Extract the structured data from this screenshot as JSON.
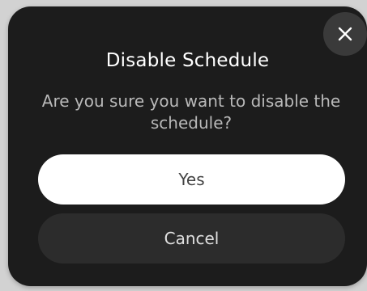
{
  "dialog": {
    "title": "Disable Schedule",
    "message": "Are you sure you want to disable the schedule?",
    "confirm_label": "Yes",
    "cancel_label": "Cancel",
    "close_icon": "close-icon"
  },
  "colors": {
    "modal_background": "#1c1c1c",
    "confirm_button": "#ffffff",
    "cancel_button": "#2c2c2c",
    "close_button": "#3a3a3a"
  }
}
